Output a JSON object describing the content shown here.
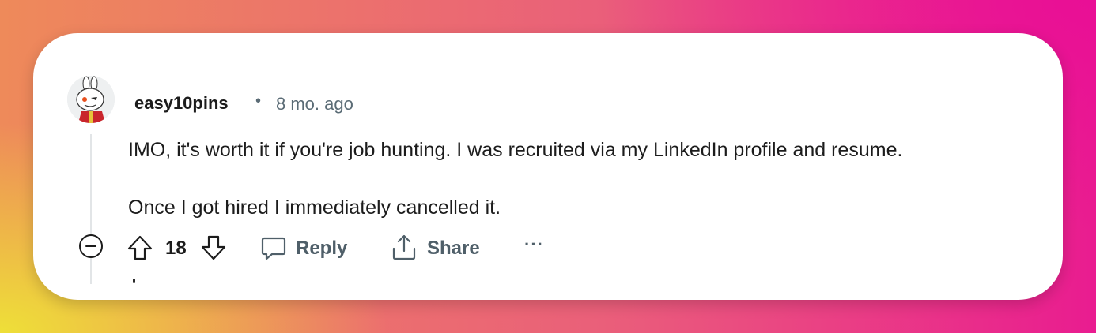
{
  "comment": {
    "author": "easy10pins",
    "separator": "•",
    "time": "8 mo. ago",
    "paragraphs": [
      "IMO, it's worth it if you're job hunting. I was recruited via my LinkedIn profile and resume.",
      "Once I got hired I immediately cancelled it."
    ],
    "score": "18"
  },
  "actions": {
    "reply_label": "Reply",
    "share_label": "Share",
    "more_label": "···"
  },
  "icons": {
    "collapse": "minus-circle-icon",
    "upvote": "arrow-up-icon",
    "downvote": "arrow-down-icon",
    "reply": "speech-bubble-icon",
    "share": "share-icon",
    "more": "ellipsis-icon"
  },
  "colors": {
    "text": "#1c1c1c",
    "muted": "#5a6b75",
    "card": "#ffffff"
  }
}
